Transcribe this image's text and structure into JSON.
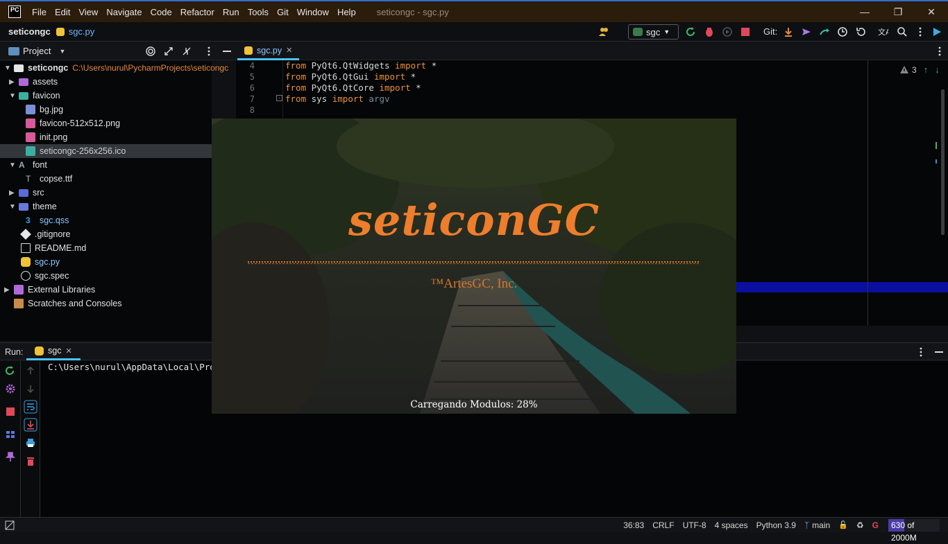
{
  "window": {
    "title": "seticongc - sgc.py",
    "menu": [
      "File",
      "Edit",
      "View",
      "Navigate",
      "Code",
      "Refactor",
      "Run",
      "Tools",
      "Git",
      "Window",
      "Help"
    ]
  },
  "navbar": {
    "project": "seticongc",
    "file": "sgc.py",
    "run_config": "sgc",
    "git_label": "Git:"
  },
  "project_panel": {
    "title": "Project",
    "root": {
      "name": "seticongc",
      "path": "C:\\Users\\nurul\\PycharmProjects\\seticongc"
    },
    "items": [
      {
        "label": "assets"
      },
      {
        "label": "favicon"
      },
      {
        "label": "bg.jpg"
      },
      {
        "label": "favicon-512x512.png"
      },
      {
        "label": "init.png"
      },
      {
        "label": "seticongc-256x256.ico"
      },
      {
        "label": "font"
      },
      {
        "label": "copse.ttf"
      },
      {
        "label": "src"
      },
      {
        "label": "theme"
      },
      {
        "label": "sgc.qss"
      },
      {
        "label": ".gitignore"
      },
      {
        "label": "README.md"
      },
      {
        "label": "sgc.py"
      },
      {
        "label": "sgc.spec"
      },
      {
        "label": "External Libraries"
      },
      {
        "label": "Scratches and Consoles"
      }
    ]
  },
  "editor": {
    "tab": "sgc.py",
    "warnings": "3",
    "lines": [
      {
        "num": "4",
        "kw1": "from",
        "mod": " PyQt6.QtWidgets ",
        "kw2": "import",
        "rest": " *"
      },
      {
        "num": "5",
        "kw1": "from",
        "mod": " PyQt6.QtGui ",
        "kw2": "import",
        "rest": " *"
      },
      {
        "num": "6",
        "kw1": "from",
        "mod": " PyQt6.QtCore ",
        "kw2": "import",
        "rest": " *"
      },
      {
        "num": "7",
        "kw1": "from",
        "mod": " sys ",
        "kw2": "import",
        "rest": " argv"
      },
      {
        "num": "8",
        "kw1": "",
        "mod": "",
        "kw2": "",
        "rest": ""
      }
    ]
  },
  "run_panel": {
    "label": "Run:",
    "tab": "sgc",
    "console_text": "C:\\Users\\nurul\\AppData\\Local\\Progr"
  },
  "splash": {
    "title": "seticonGC",
    "company": "™ArtesGC, Inc.",
    "status": "Carregando Modulos: 28%",
    "progress_percent": 28
  },
  "statusbar": {
    "position": "36:83",
    "line_sep": "CRLF",
    "encoding": "UTF-8",
    "indent": "4 spaces",
    "interpreter": "Python 3.9",
    "branch": "main",
    "memory": "630 of 2000M",
    "memory_fraction": 0.315
  }
}
